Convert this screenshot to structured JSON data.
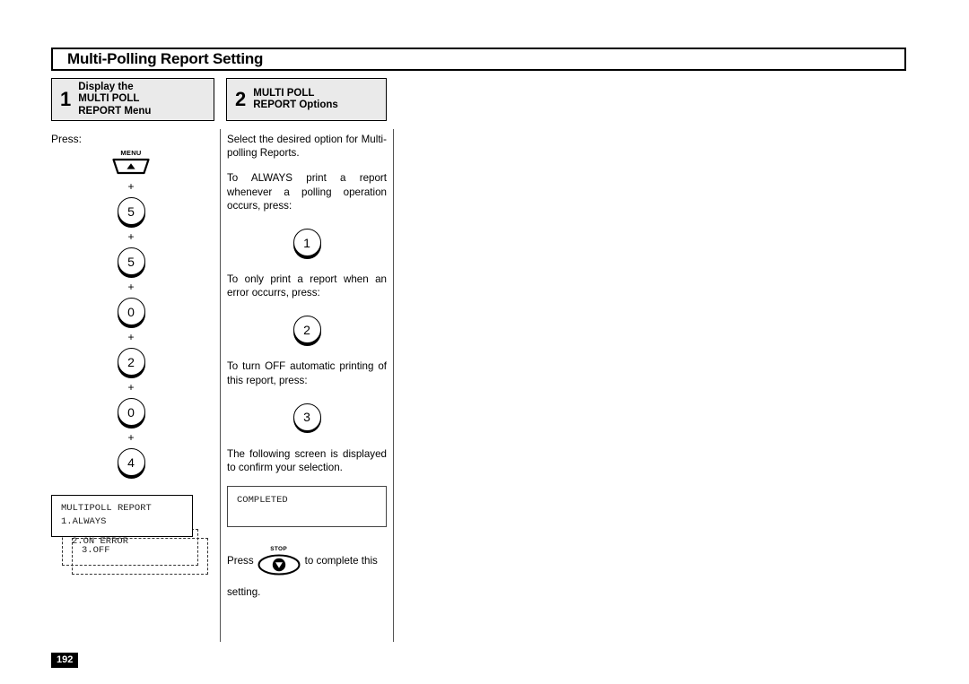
{
  "page": {
    "title": "Multi-Polling Report Setting",
    "page_number": "192"
  },
  "steps": [
    {
      "number": "1",
      "lines": [
        "Display the",
        "MULTI POLL",
        "REPORT Menu"
      ]
    },
    {
      "number": "2",
      "lines": [
        "MULTI POLL",
        "REPORT Options"
      ]
    }
  ],
  "left_column": {
    "press_label": "Press:",
    "menu_key": {
      "cap_label": "MENU",
      "icon": "up-triangle-icon"
    },
    "plus": "+",
    "keys": [
      "5",
      "5",
      "0",
      "2",
      "0",
      "4"
    ],
    "lcd": {
      "front": {
        "line1": "MULTIPOLL REPORT",
        "line2": "1.ALWAYS"
      },
      "behind_1": "2.ON ERROR",
      "behind_2": "3.OFF"
    }
  },
  "right_column": {
    "para_intro": "Select the desired option for Multi-polling Reports.",
    "para_always": "To ALWAYS print a report whenever a polling operation occurs, press:",
    "key_always": "1",
    "para_on_error": "To only print a report when an error occurrs, press:",
    "key_on_error": "2",
    "para_off": "To turn OFF automatic printing of this report, press:",
    "key_off": "3",
    "para_confirm": "The following screen is displayed to confirm your selection.",
    "lcd_completed": "COMPLETED",
    "stop_sentence": {
      "lead": "Press",
      "key_cap": "STOP",
      "trail": "to complete this",
      "tail": "setting."
    }
  }
}
